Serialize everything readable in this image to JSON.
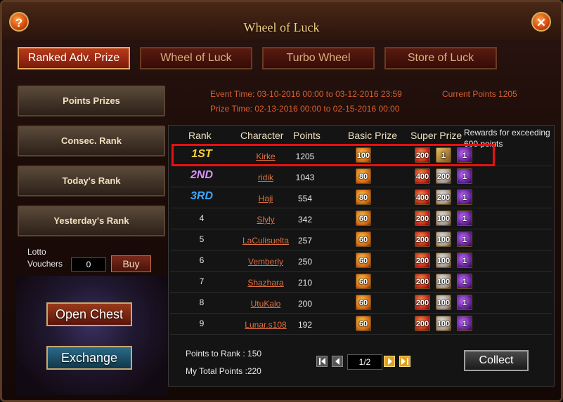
{
  "window": {
    "title": "Wheel of Luck"
  },
  "icons": {
    "help": "?",
    "close": "✕"
  },
  "tabs": [
    {
      "label": "Ranked Adv. Prize",
      "active": true
    },
    {
      "label": "Wheel of Luck",
      "active": false
    },
    {
      "label": "Turbo Wheel",
      "active": false
    },
    {
      "label": "Store of Luck",
      "active": false
    }
  ],
  "sidebar": {
    "buttons": [
      "Points Prizes",
      "Consec. Rank",
      "Today's Rank",
      "Yesterday's Rank"
    ],
    "lotto_label": "Lotto Vouchers",
    "lotto_value": "0",
    "buy_label": "Buy",
    "open_chest_label": "Open Chest",
    "exchange_label": "Exchange"
  },
  "event": {
    "event_time": "Event Time: 03-10-2016 00:00 to 03-12-2016 23:59",
    "prize_time": "Prize Time: 02-13-2016 00:00 to 02-15-2016 00:00",
    "current_points": "Current Points 1205"
  },
  "table": {
    "headers": {
      "rank": "Rank",
      "character": "Character",
      "points": "Points",
      "basic": "Basic Prize",
      "super": "Super Prize",
      "rewards": "Rewards for exceeding 600 points"
    },
    "rows": [
      {
        "rank": "1ST",
        "name": "Kirke",
        "points": "1205",
        "basic": "100",
        "super": [
          "200",
          "1",
          "1"
        ]
      },
      {
        "rank": "2ND",
        "name": "ridik",
        "points": "1043",
        "basic": "80",
        "super": [
          "400",
          "200",
          "1"
        ]
      },
      {
        "rank": "3RD",
        "name": "Haji",
        "points": "554",
        "basic": "80",
        "super": [
          "400",
          "200",
          "1"
        ]
      },
      {
        "rank": "4",
        "name": "Slyly",
        "points": "342",
        "basic": "60",
        "super": [
          "200",
          "100",
          "1"
        ]
      },
      {
        "rank": "5",
        "name": "LaCulisuelta",
        "points": "257",
        "basic": "60",
        "super": [
          "200",
          "100",
          "1"
        ]
      },
      {
        "rank": "6",
        "name": "Vemberly",
        "points": "250",
        "basic": "60",
        "super": [
          "200",
          "100",
          "1"
        ]
      },
      {
        "rank": "7",
        "name": "Shazhara",
        "points": "210",
        "basic": "60",
        "super": [
          "200",
          "100",
          "1"
        ]
      },
      {
        "rank": "8",
        "name": "UtuKalo",
        "points": "200",
        "basic": "60",
        "super": [
          "200",
          "100",
          "1"
        ]
      },
      {
        "rank": "9",
        "name": "Lunar.s108",
        "points": "192",
        "basic": "60",
        "super": [
          "200",
          "100",
          "1"
        ]
      }
    ]
  },
  "footer": {
    "points_to_rank": "Points to Rank : 150",
    "total_points": "My Total Points :220",
    "page": "1/2",
    "collect_label": "Collect"
  }
}
